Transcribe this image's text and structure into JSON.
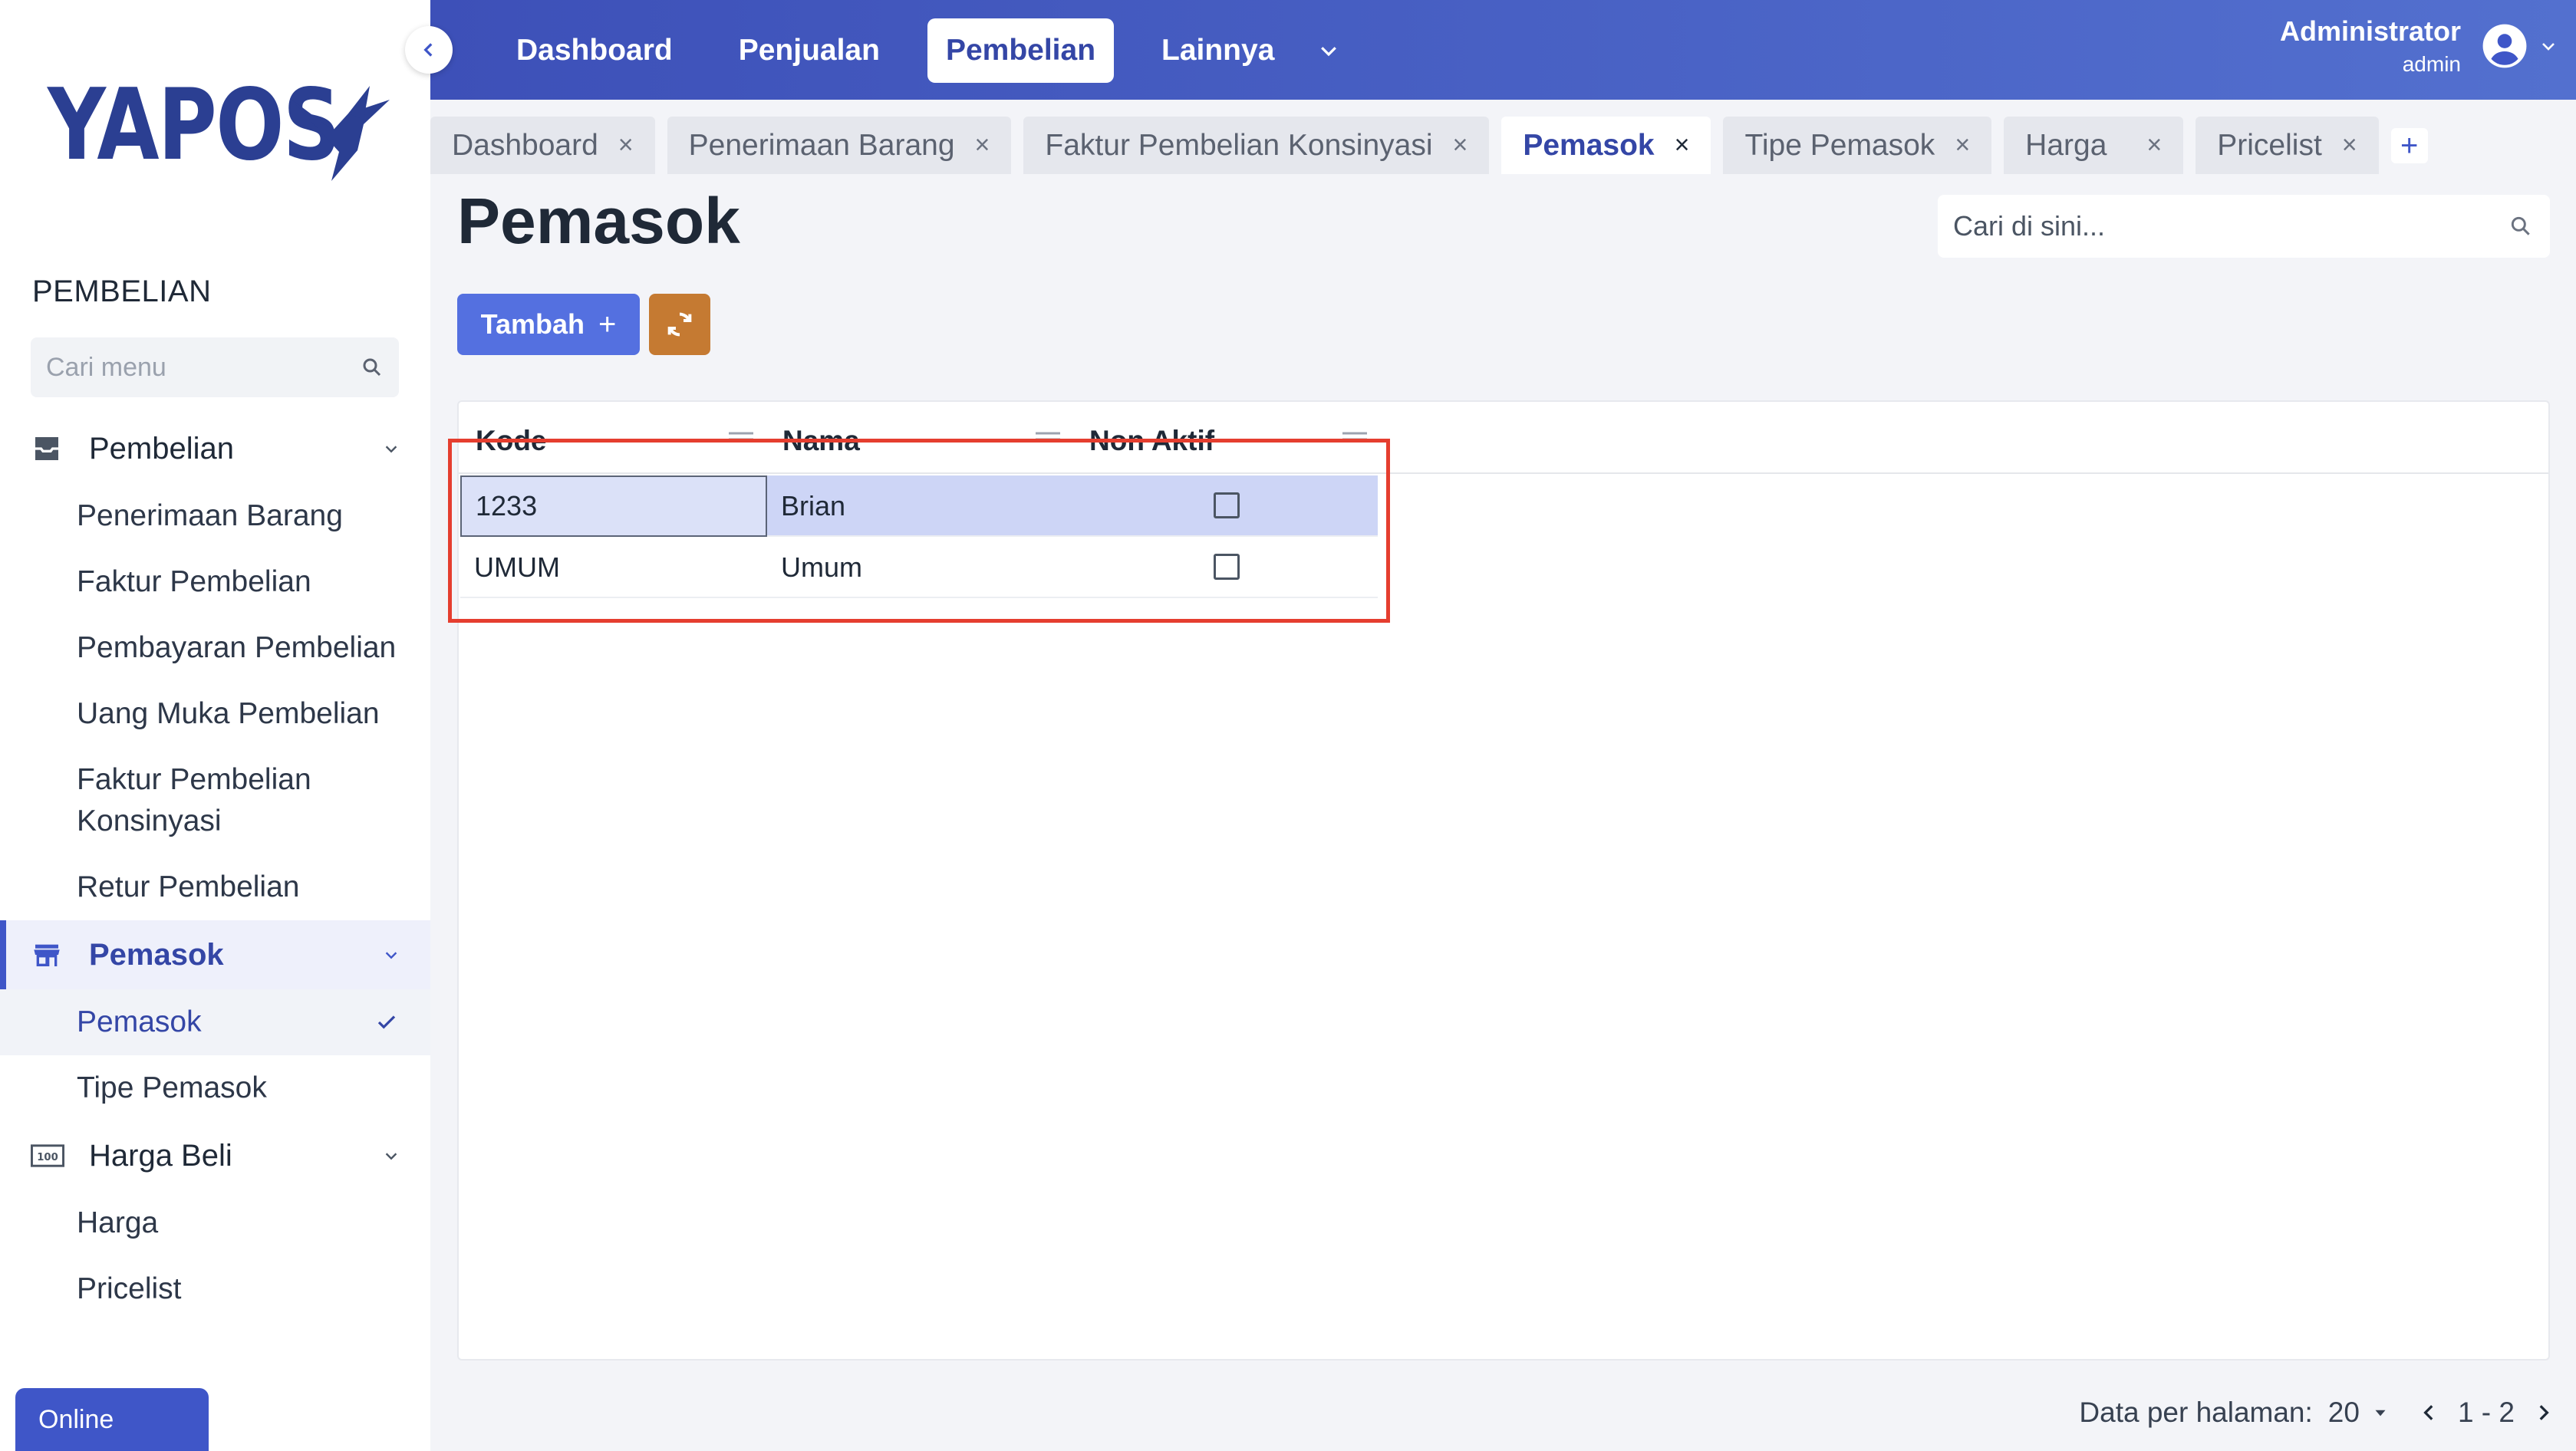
{
  "brand": {
    "logo_text": "YAPOS"
  },
  "sidebar": {
    "section_title": "PEMBELIAN",
    "search_placeholder": "Cari menu",
    "groups": [
      {
        "label": "Pembelian",
        "icon": "inbox-tray-icon",
        "items": [
          {
            "label": "Penerimaan Barang"
          },
          {
            "label": "Faktur Pembelian"
          },
          {
            "label": "Pembayaran Pembelian"
          },
          {
            "label": "Uang Muka Pembelian"
          },
          {
            "label": "Faktur Pembelian Konsinyasi"
          },
          {
            "label": "Retur Pembelian"
          }
        ]
      },
      {
        "label": "Pemasok",
        "icon": "store-icon",
        "active": true,
        "items": [
          {
            "label": "Pemasok",
            "current": true
          },
          {
            "label": "Tipe Pemasok"
          }
        ]
      },
      {
        "label": "Harga Beli",
        "icon": "price-tag-icon",
        "items": [
          {
            "label": "Harga"
          },
          {
            "label": "Pricelist"
          }
        ]
      }
    ],
    "status_label": "Online"
  },
  "topnav": {
    "items": [
      {
        "label": "Dashboard"
      },
      {
        "label": "Penjualan"
      },
      {
        "label": "Pembelian",
        "active": true
      },
      {
        "label": "Lainnya"
      }
    ]
  },
  "user": {
    "name": "Administrator",
    "role": "admin"
  },
  "tabs": [
    {
      "label": "Dashboard"
    },
    {
      "label": "Penerimaan Barang"
    },
    {
      "label": "Faktur Pembelian Konsinyasi"
    },
    {
      "label": "Pemasok",
      "active": true
    },
    {
      "label": "Tipe Pemasok"
    },
    {
      "label": "Harga"
    },
    {
      "label": "Pricelist"
    }
  ],
  "page": {
    "title": "Pemasok",
    "search_placeholder": "Cari di sini...",
    "add_button": "Tambah",
    "add_button_symbol": "+"
  },
  "grid": {
    "columns": [
      "Kode",
      "Nama",
      "Non Aktif"
    ],
    "rows": [
      {
        "kode": "1233",
        "nama": "Brian",
        "non_aktif": false,
        "selected": true
      },
      {
        "kode": "UMUM",
        "nama": "Umum",
        "non_aktif": false,
        "selected": false
      }
    ]
  },
  "footer": {
    "per_page_label": "Data per halaman:",
    "per_page_value": "20",
    "range": "1 - 2"
  },
  "colors": {
    "primary": "#3f56c8",
    "topbar_start": "#3d50b8",
    "topbar_end": "#5370cf",
    "refresh_button": "#c57a32",
    "highlight": "#e53e2f",
    "selected_row": "#cdd5f6"
  }
}
